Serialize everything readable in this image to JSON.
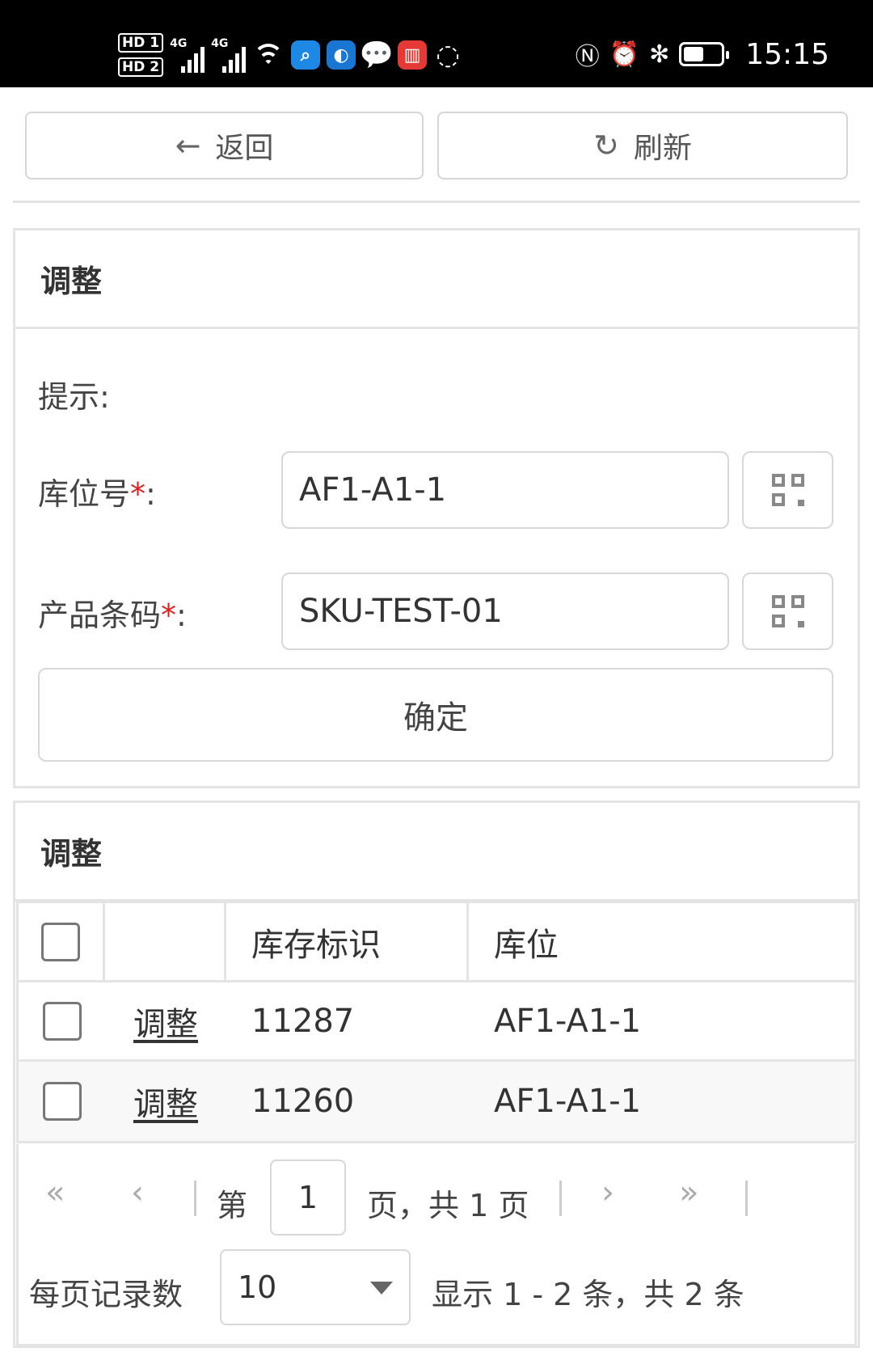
{
  "status_bar": {
    "sim1": "HD 1",
    "sim2": "HD 2",
    "net1": "4G",
    "net2": "4G",
    "time": "15:15"
  },
  "toolbar": {
    "back_label": "返回",
    "refresh_label": "刷新"
  },
  "form_panel": {
    "title": "调整",
    "hint_label": "提示:",
    "location_label": "库位号",
    "location_value": "AF1-A1-1",
    "barcode_label": "产品条码",
    "barcode_value": "SKU-TEST-01",
    "required_mark": "*",
    "colon": ":",
    "confirm_label": "确定"
  },
  "list_panel": {
    "title": "调整",
    "columns": [
      "",
      "",
      "库存标识",
      "库位"
    ],
    "rows": [
      {
        "action": "调整",
        "stock_id": "11287",
        "location": "AF1-A1-1"
      },
      {
        "action": "调整",
        "stock_id": "11260",
        "location": "AF1-A1-1"
      }
    ]
  },
  "pagination": {
    "first_icon": "double-chevron-left-icon",
    "prev_icon": "chevron-left-icon",
    "next_icon": "chevron-right-icon",
    "last_icon": "double-chevron-right-icon",
    "page_prefix": "第",
    "current_page": "1",
    "page_suffix": "页，共 1 页",
    "per_page_label": "每页记录数",
    "per_page_value": "10",
    "summary": "显示 1 - 2 条，共 2 条"
  }
}
